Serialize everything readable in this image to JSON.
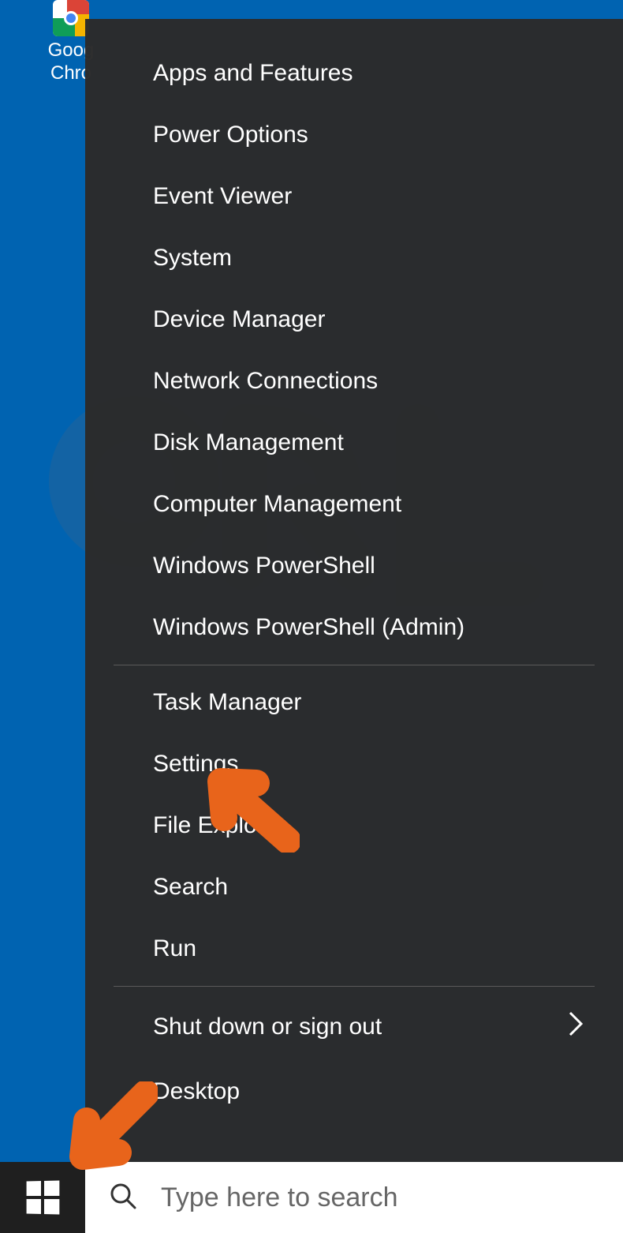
{
  "desktop": {
    "chrome_label_line1": "Goog",
    "chrome_label_line2": "Chro"
  },
  "winx_menu": {
    "group1": [
      "Apps and Features",
      "Power Options",
      "Event Viewer",
      "System",
      "Device Manager",
      "Network Connections",
      "Disk Management",
      "Computer Management",
      "Windows PowerShell",
      "Windows PowerShell (Admin)"
    ],
    "group2": [
      "Task Manager",
      "Settings",
      "File Explorer",
      "Search",
      "Run"
    ],
    "group3": [
      {
        "label": "Shut down or sign out",
        "submenu": true
      },
      {
        "label": "Desktop",
        "submenu": false
      }
    ]
  },
  "taskbar": {
    "search_placeholder": "Type here to search"
  },
  "colors": {
    "desktop_bg": "#0063b1",
    "menu_bg": "#2b2b2b",
    "arrow": "#e8641b"
  }
}
